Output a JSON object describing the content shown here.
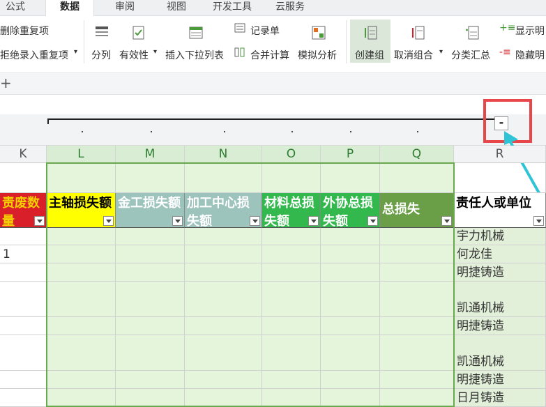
{
  "tabs": [
    "公式",
    "数据",
    "审阅",
    "视图",
    "开发工具",
    "云服务"
  ],
  "active_tab": "数据",
  "ribbon": {
    "remove_duplicates": "删除重复项",
    "reject_duplicates": "拒绝录入重复项",
    "split": "分列",
    "validity": "有效性",
    "insert_dropdown": "插入下拉列表",
    "record_form": "记录单",
    "merge_calc": "合并计算",
    "simulation": "模拟分析",
    "create_group": "创建组",
    "ungroup": "取消组合",
    "subtotal": "分类汇总",
    "show_detail": "显示明",
    "hide_detail": "隐藏明"
  },
  "plus_symbol": "+",
  "outline": {
    "collapse_symbol": "-"
  },
  "columns": [
    "K",
    "L",
    "M",
    "N",
    "O",
    "P",
    "Q",
    "R"
  ],
  "selected_columns": [
    "L",
    "M",
    "N",
    "O",
    "P",
    "Q"
  ],
  "headers": [
    {
      "text": "责废数量",
      "bg": "#d9202a",
      "color": "#f5d000"
    },
    {
      "text": "主轴损失额",
      "bg": "#ffff00",
      "color": "#000000"
    },
    {
      "text": "金工损失额",
      "bg": "#9dc3bd",
      "color": "#ffffff"
    },
    {
      "text": "加工中心损失额",
      "bg": "#9dc3bd",
      "color": "#ffffff"
    },
    {
      "text": "材料总损失额",
      "bg": "#33b84d",
      "color": "#ffffff"
    },
    {
      "text": "外协总损失额",
      "bg": "#33b84d",
      "color": "#ffffff"
    },
    {
      "text": "总损失",
      "bg": "#6a9e47",
      "color": "#ffffff"
    },
    {
      "text": "责任人或单位",
      "bg": "#ffffff",
      "color": "#000000"
    }
  ],
  "rows": [
    {
      "k": "",
      "r": "宇力机械"
    },
    {
      "k": "1",
      "r": "何龙佳"
    },
    {
      "k": "",
      "r": "明捷铸造"
    },
    {
      "k": "",
      "r": "凯通机械"
    },
    {
      "k": "",
      "r": "明捷铸造"
    },
    {
      "k": "",
      "r": "凯通机械"
    },
    {
      "k": "",
      "r": "明捷铸造"
    },
    {
      "k": "",
      "r": "日月铸造"
    }
  ],
  "colors": {
    "selection": "#e4f5dc",
    "selection_border": "#6aa84f",
    "annotation": "#e8474a",
    "arrow": "#2ec4d6"
  }
}
